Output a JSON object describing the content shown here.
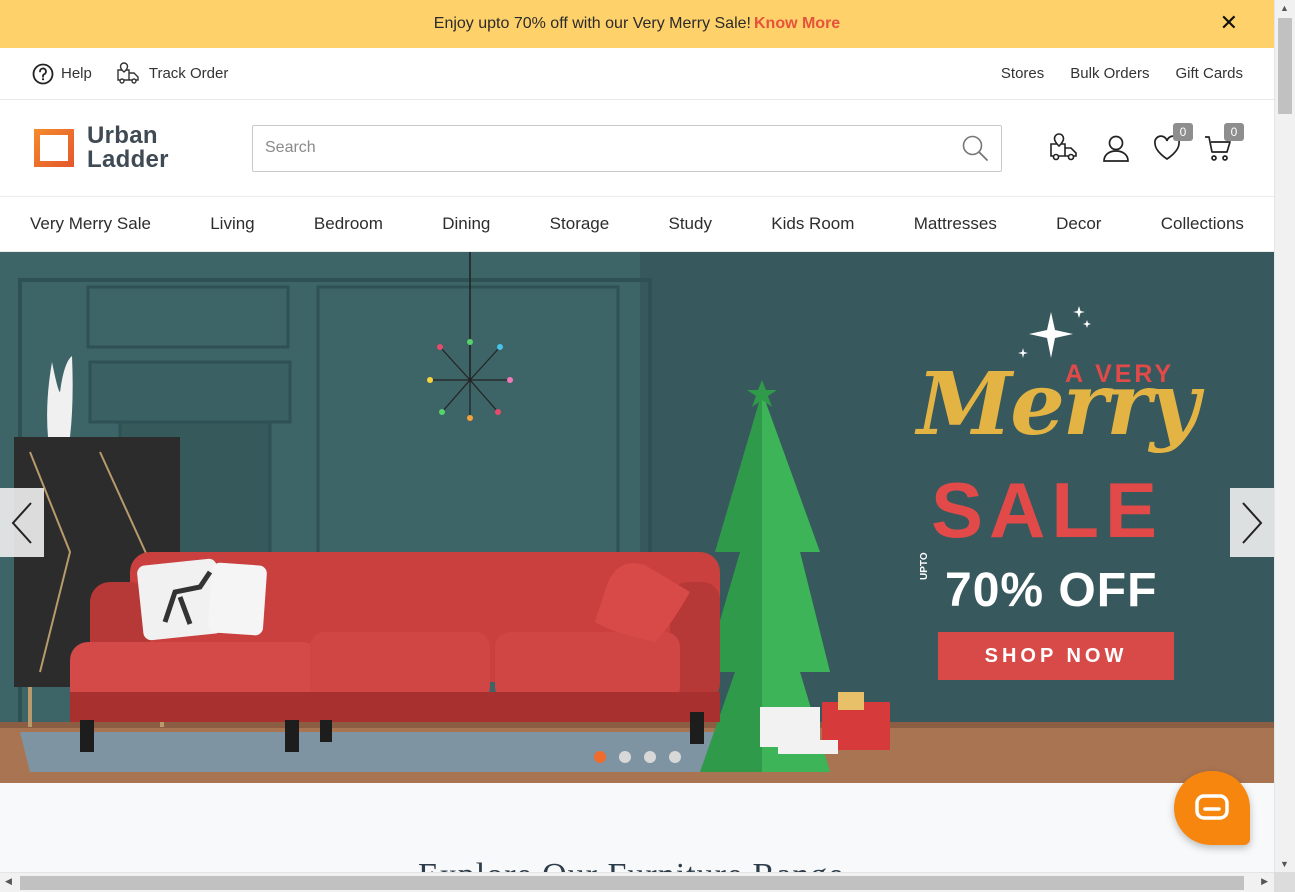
{
  "promo": {
    "text": "Enjoy upto 70% off with our Very Merry Sale!",
    "link": "Know More",
    "close_symbol": "✕"
  },
  "utility": {
    "help": "Help",
    "track_order": "Track Order",
    "stores": "Stores",
    "bulk_orders": "Bulk Orders",
    "gift_cards": "Gift Cards"
  },
  "header": {
    "logo_line1": "Urban",
    "logo_line2": "Ladder",
    "search_placeholder": "Search",
    "wishlist_count": "0",
    "cart_count": "0"
  },
  "nav": [
    "Very Merry Sale",
    "Living",
    "Bedroom",
    "Dining",
    "Storage",
    "Study",
    "Kids Room",
    "Mattresses",
    "Decor",
    "Collections"
  ],
  "hero": {
    "a_very": "A VERY",
    "merry": "Merry",
    "sale": "SALE",
    "upto": "UPTO",
    "off": "70% OFF",
    "cta": "SHOP NOW",
    "slide_count": 4,
    "active_slide": 1
  },
  "section": {
    "title": "Explore Our Furniture Range"
  },
  "colors": {
    "promo_bg": "#ffd16a",
    "accent": "#e5533d",
    "brand_orange": "#f06c2c",
    "sale_red": "#e14a49",
    "gold": "#e3b443",
    "wall": "#3e6366",
    "chat": "#f7860f"
  }
}
